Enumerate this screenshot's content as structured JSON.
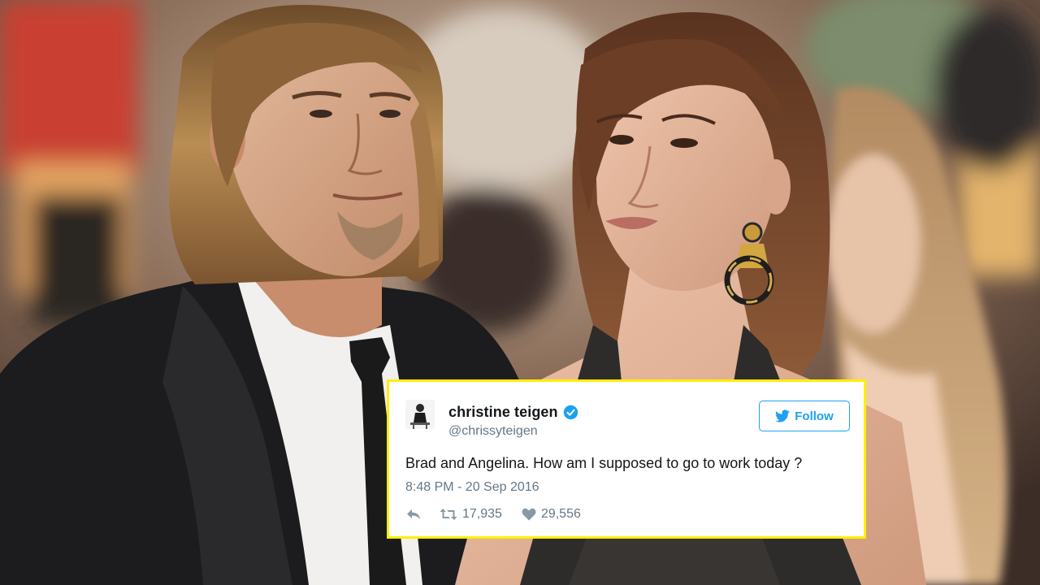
{
  "tweet": {
    "display_name": "christine teigen",
    "handle": "@chrissyteigen",
    "follow_label": "Follow",
    "text": "Brad and Angelina. How am I supposed to go to work today ?",
    "timestamp": "8:48 PM - 20 Sep 2016",
    "retweet_count": "17,935",
    "like_count": "29,556",
    "icons": [
      "verified-badge-icon",
      "twitter-bird-icon",
      "reply-icon",
      "retweet-icon",
      "heart-icon"
    ]
  },
  "colors": {
    "card_border": "#ffef00",
    "twitter_blue": "#1da1f2",
    "muted_text": "#657786"
  }
}
